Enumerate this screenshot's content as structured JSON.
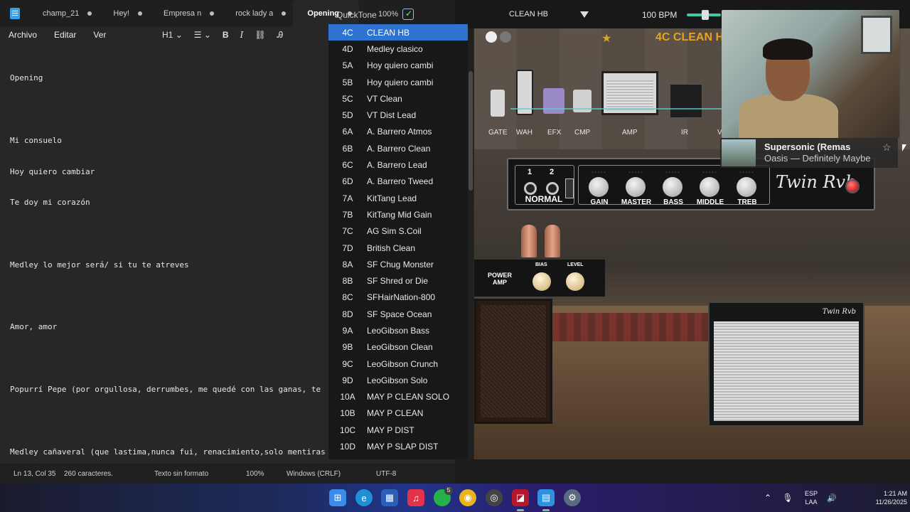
{
  "notepad": {
    "tabs": [
      {
        "label": "champ_21",
        "active": false
      },
      {
        "label": "Hey!",
        "active": false
      },
      {
        "label": "Empresa n",
        "active": false
      },
      {
        "label": "rock lady a",
        "active": false
      },
      {
        "label": "Opening",
        "active": true
      }
    ],
    "menu": [
      "Archivo",
      "Editar",
      "Ver"
    ],
    "format": {
      "heading": "H1",
      "bold": "B",
      "italic": "I"
    },
    "lines": [
      "Opening",
      "",
      "Mi consuelo",
      "Hoy quiero cambiar",
      "Te doy mi corazón",
      "",
      "Medley lo mejor será/ si tu te atreves",
      "",
      "Amor, amor",
      "",
      "Popurrí Pepe (por orgullosa, derrumbes, me quedé con las ganas, te",
      "",
      "Medley cañaveral (que lastima,nunca fui, renacimiento,solo mentiras"
    ],
    "status": {
      "position": "Ln 13, Col 35",
      "chars": "260 caracteres.",
      "format": "Texto sin formato",
      "zoom": "100%",
      "eol": "Windows (CRLF)",
      "encoding": "UTF-8"
    }
  },
  "quicktone": {
    "title": "QuickTone",
    "zoom": "100%",
    "preset_select": "CLEAN HB",
    "bpm": "100 BPM",
    "bpm_value": 0.55,
    "preset_title": "4C CLEAN H",
    "chain": [
      "GATE",
      "WAH",
      "EFX",
      "CMP",
      "AMP",
      "IR",
      "V"
    ],
    "presets": [
      {
        "code": "4C",
        "name": "CLEAN HB",
        "selected": true
      },
      {
        "code": "4D",
        "name": "Medley clasico"
      },
      {
        "code": "5A",
        "name": "Hoy quiero cambi"
      },
      {
        "code": "5B",
        "name": "Hoy quiero cambi"
      },
      {
        "code": "5C",
        "name": "VT Clean"
      },
      {
        "code": "5D",
        "name": "VT Dist Lead"
      },
      {
        "code": "6A",
        "name": "A. Barrero Atmos"
      },
      {
        "code": "6B",
        "name": "A. Barrero Clean"
      },
      {
        "code": "6C",
        "name": "A. Barrero Lead"
      },
      {
        "code": "6D",
        "name": "A. Barrero Tweed"
      },
      {
        "code": "7A",
        "name": "KitTang Lead"
      },
      {
        "code": "7B",
        "name": "KitTang Mid Gain"
      },
      {
        "code": "7C",
        "name": "AG Sim S.Coil"
      },
      {
        "code": "7D",
        "name": "British Clean"
      },
      {
        "code": "8A",
        "name": "SF Chug Monster"
      },
      {
        "code": "8B",
        "name": "SF Shred or Die"
      },
      {
        "code": "8C",
        "name": "SFHairNation-800"
      },
      {
        "code": "8D",
        "name": "SF Space Ocean"
      },
      {
        "code": "9A",
        "name": "LeoGibson Bass"
      },
      {
        "code": "9B",
        "name": "LeoGibson Clean"
      },
      {
        "code": "9C",
        "name": "LeoGibson Crunch"
      },
      {
        "code": "9D",
        "name": "LeoGibson Solo"
      },
      {
        "code": "10A",
        "name": "MAY P CLEAN SOLO"
      },
      {
        "code": "10B",
        "name": "MAY P CLEAN"
      },
      {
        "code": "10C",
        "name": "MAY P DIST"
      },
      {
        "code": "10D",
        "name": "MAY P SLAP DIST"
      }
    ],
    "amp": {
      "inputs": [
        "1",
        "2"
      ],
      "channel": "NORMAL",
      "knobs": [
        "GAIN",
        "MASTER",
        "BASS",
        "MIDDLE",
        "TREB"
      ],
      "logo": "Twin Rvb",
      "power_amp_label": "POWER AMP",
      "power_knobs": [
        "BIAS",
        "LEVEL"
      ],
      "cab_logo": "Twin Rvb"
    }
  },
  "now_playing": {
    "song": "Supersonic (Remas",
    "artist": "Oasis — Definitely Maybe"
  },
  "taskbar": {
    "lang_top": "ESP",
    "lang_bottom": "LAA",
    "time": "1:21 AM",
    "date": "11/26/2025",
    "whatsapp_badge": "5"
  },
  "colors": {
    "accent": "#2f73d0",
    "preset_title": "#e8a21c",
    "bpm_slider": "#3bc9a9"
  }
}
